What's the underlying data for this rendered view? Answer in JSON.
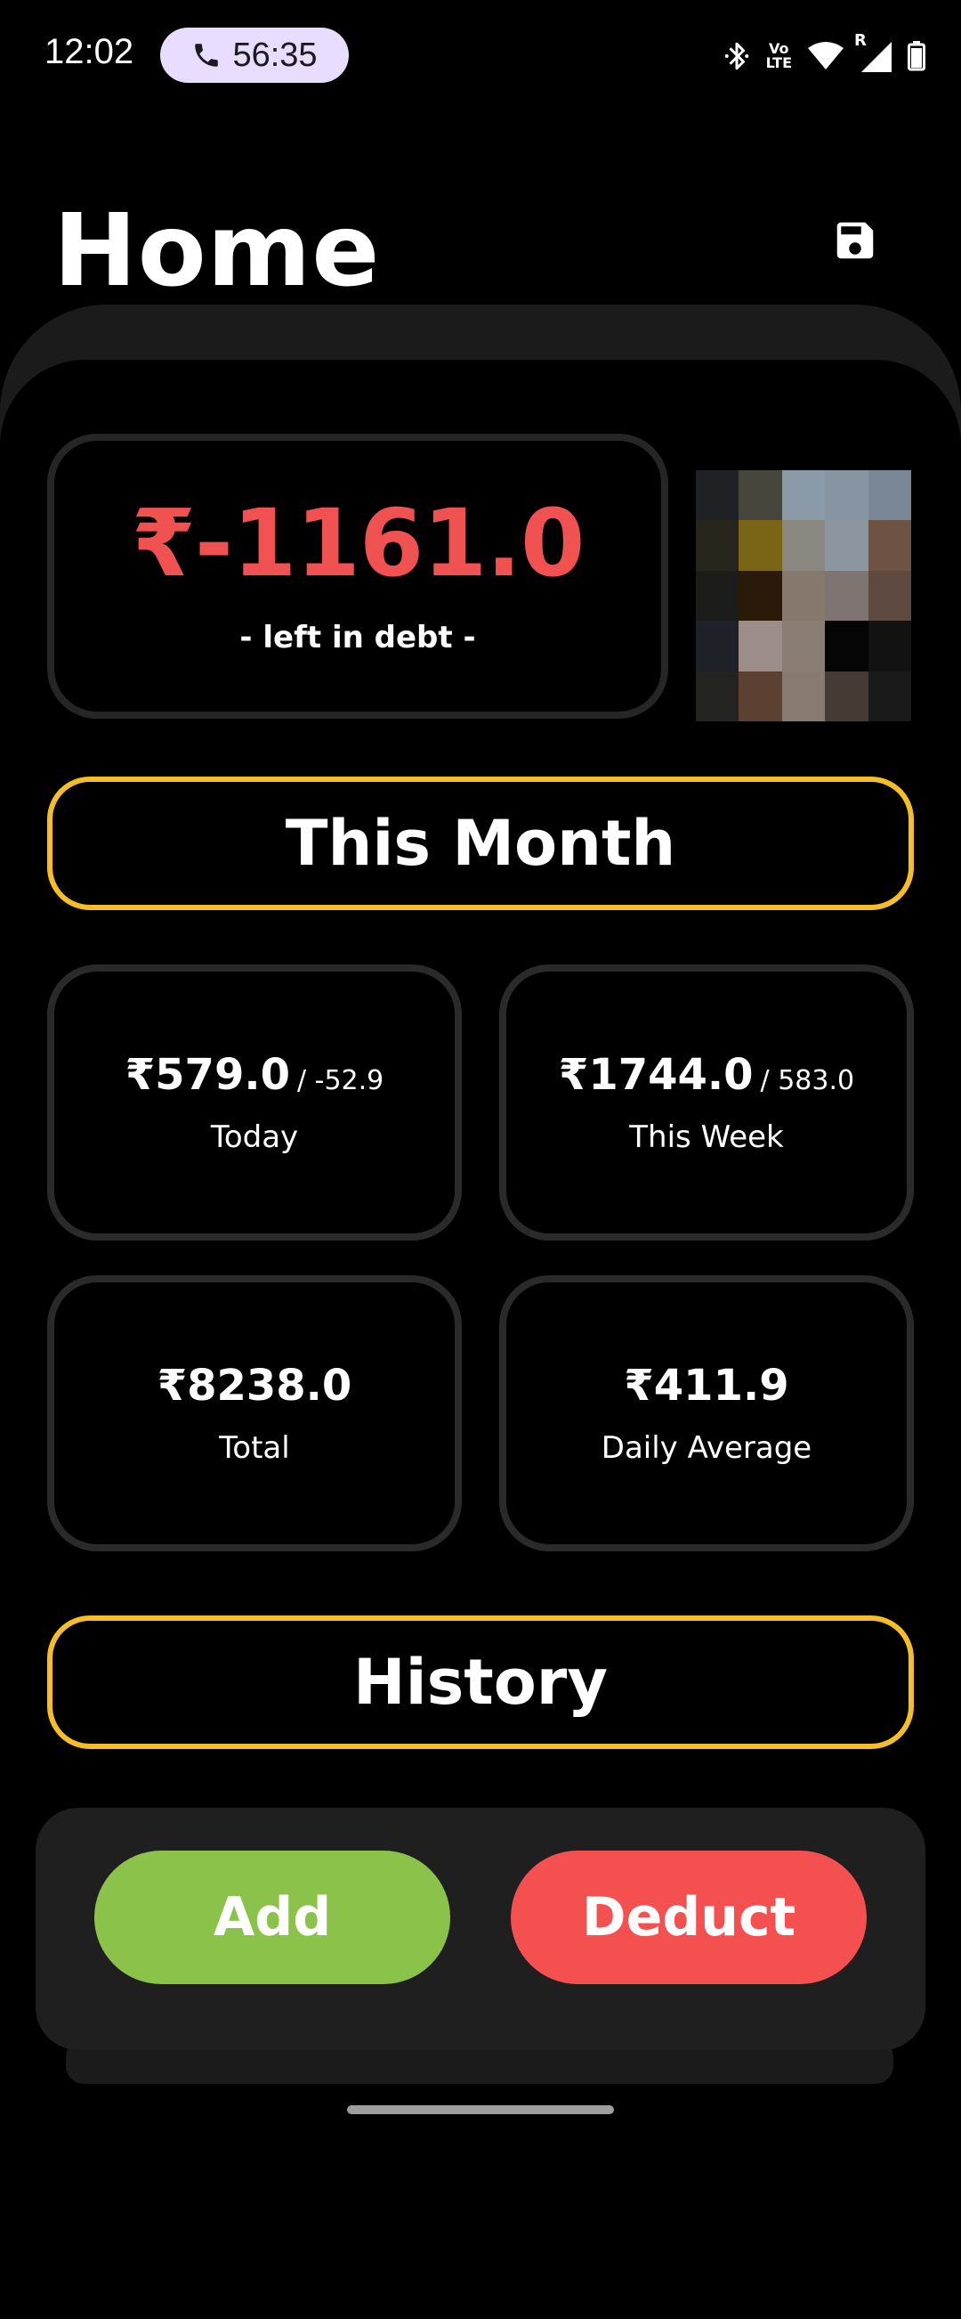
{
  "status_bar": {
    "time": "12:02",
    "call_duration": "56:35",
    "volte_top": "Vo",
    "volte_bottom": "LTE",
    "roaming": "R"
  },
  "header": {
    "title": "Home"
  },
  "balance": {
    "value": "₹-1161.0",
    "label": "- left in debt -"
  },
  "sections": {
    "this_month": "This Month",
    "history": "History"
  },
  "stats": {
    "today": {
      "value": "₹579.0",
      "sub": "/ -52.9",
      "label": "Today"
    },
    "week": {
      "value": "₹1744.0",
      "sub": "/ 583.0",
      "label": "This Week"
    },
    "total": {
      "value": "₹8238.0",
      "label": "Total"
    },
    "daily_avg": {
      "value": "₹411.9",
      "label": "Daily Average"
    }
  },
  "actions": {
    "add": "Add",
    "deduct": "Deduct"
  },
  "colors": {
    "debt": "#F05252",
    "accent": "#F5BE27",
    "add": "#8BC34A",
    "deduct": "#F55050"
  },
  "avatar_pixels": [
    "#1f2124",
    "#46463c",
    "#8b9aa8",
    "#8795a2",
    "#7a8796",
    "#26261c",
    "#7a6415",
    "#8a8680",
    "#8c96a0",
    "#6e5244",
    "#1c1d1b",
    "#2a1a0a",
    "#86786d",
    "#7e7572",
    "#5e4a40",
    "#1e2228",
    "#9c8c8a",
    "#8a7e74",
    "#050505",
    "#121212",
    "#23231f",
    "#5c4032",
    "#887a70",
    "#463a34",
    "#1a1a1a"
  ]
}
